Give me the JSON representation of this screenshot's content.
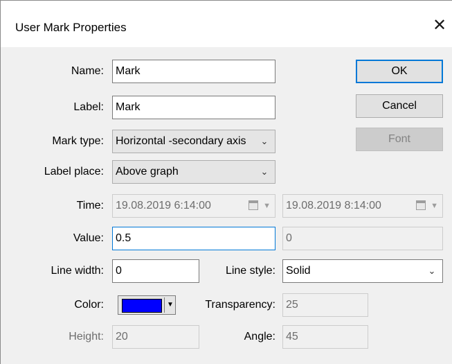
{
  "window": {
    "title": "User Mark Properties",
    "close_glyph": "✕"
  },
  "fields": {
    "name": {
      "label": "Name:",
      "value": "Mark"
    },
    "label": {
      "label": "Label:",
      "value": "Mark"
    },
    "mark_type": {
      "label": "Mark type:",
      "value": "Horizontal -secondary axis"
    },
    "label_place": {
      "label": "Label place:",
      "value": "Above graph"
    },
    "time": {
      "label": "Time:",
      "start": "19.08.2019  6:14:00",
      "end": "19.08.2019  8:14:00"
    },
    "value": {
      "label": "Value:",
      "value": "0.5",
      "second": "0"
    },
    "line_width": {
      "label": "Line width:",
      "value": "0"
    },
    "line_style": {
      "label": "Line style:",
      "value": "Solid"
    },
    "color": {
      "label": "Color:",
      "swatch": "#0000ff"
    },
    "transparency": {
      "label": "Transparency:",
      "value": "25"
    },
    "height": {
      "label": "Height:",
      "value": "20"
    },
    "angle": {
      "label": "Angle:",
      "value": "45"
    }
  },
  "buttons": {
    "ok": "OK",
    "cancel": "Cancel",
    "font": "Font"
  },
  "icons": {
    "dropdown": "chevron-down-icon",
    "calendar": "calendar-icon",
    "close": "close-icon"
  }
}
